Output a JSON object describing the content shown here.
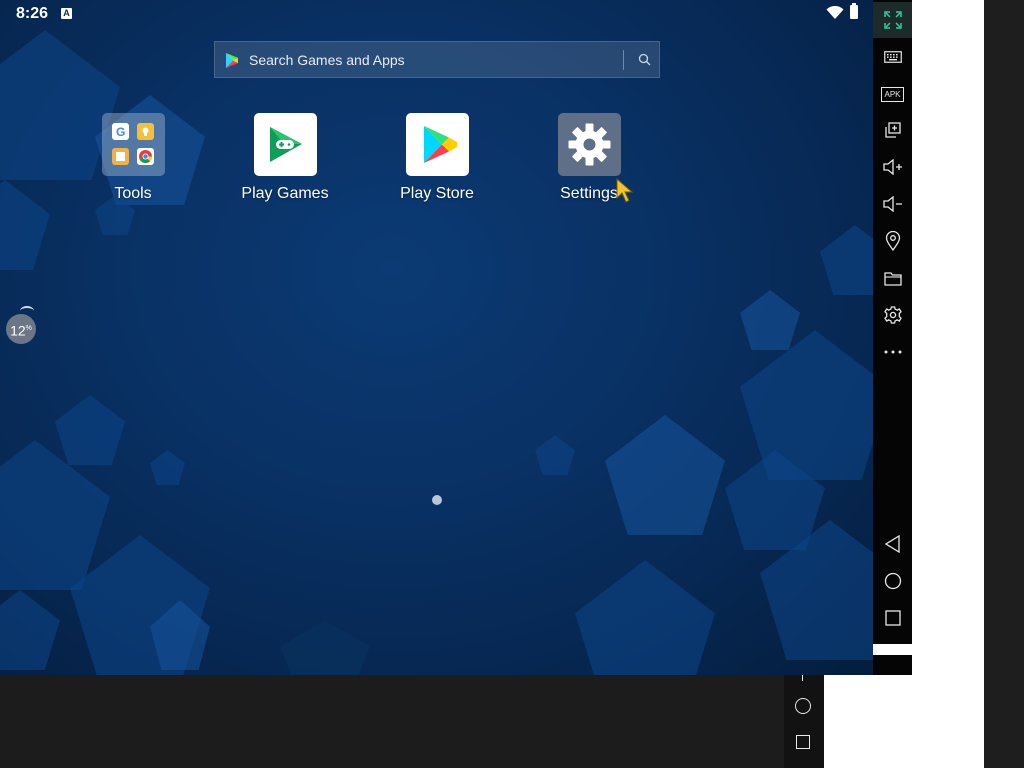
{
  "status_bar": {
    "time": "8:26",
    "notification_letter": "A"
  },
  "search": {
    "placeholder": "Search Games and Apps"
  },
  "apps": [
    {
      "label": "Tools",
      "icon": "folder-icon"
    },
    {
      "label": "Play Games",
      "icon": "play-games-icon"
    },
    {
      "label": "Play Store",
      "icon": "play-store-icon"
    },
    {
      "label": "Settings",
      "icon": "settings-gear-icon"
    }
  ],
  "badge": {
    "value": "12",
    "unit": "%"
  },
  "toolbar": {
    "items": [
      "fullscreen-icon",
      "keyboard-icon",
      "apk-icon",
      "multi-window-icon",
      "volume-up-icon",
      "volume-down-icon",
      "location-icon",
      "folder-icon",
      "settings-icon",
      "more-icon",
      "back-icon",
      "home-icon",
      "recents-icon"
    ],
    "apk_label": "APK"
  },
  "colors": {
    "wallpaper": "#093164",
    "accent_active": "#2ecc9a"
  }
}
